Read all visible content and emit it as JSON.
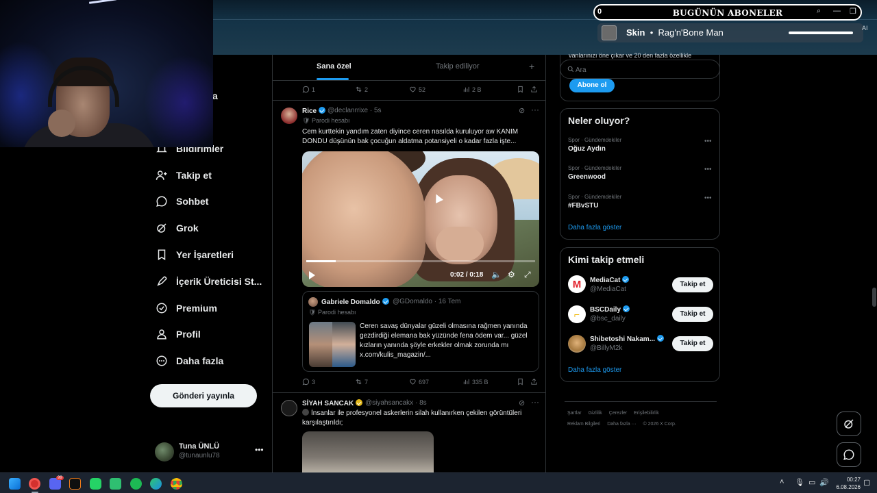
{
  "stream_overlay": {
    "alert_count": "0",
    "alert_title": "BUGÜNÜN ABONELER",
    "now_playing_title": "Skin",
    "now_playing_artist": "Rag'n'Bone Man",
    "ai_label": "AI",
    "ctrl_search": "⌕",
    "ctrl_min": "—",
    "ctrl_max": "❐",
    "ctrl_close": "✕"
  },
  "sidebar": {
    "partial_label": "a",
    "items": [
      {
        "label": "Bildirimler",
        "icon": "bell-icon"
      },
      {
        "label": "Takip et",
        "icon": "follow-icon"
      },
      {
        "label": "Sohbet",
        "icon": "chat-icon"
      },
      {
        "label": "Grok",
        "icon": "grok-icon"
      },
      {
        "label": "Yer İşaretleri",
        "icon": "bookmark-icon"
      },
      {
        "label": "İçerik Üreticisi St...",
        "icon": "rocket-icon"
      },
      {
        "label": "Premium",
        "icon": "premium-icon"
      },
      {
        "label": "Profil",
        "icon": "profile-icon"
      },
      {
        "label": "Daha fazla",
        "icon": "more-icon"
      }
    ],
    "post_button": "Gönderi yayınla",
    "account_name": "Tuna ÜNLÜ",
    "account_handle": "@tunaunlu78",
    "account_more": "•••"
  },
  "feed": {
    "tabs": {
      "for_you": "Sana özel",
      "following": "Takip ediliyor",
      "add": "+"
    },
    "top_actions": {
      "replies": "1",
      "reposts": "2",
      "likes": "52",
      "views": "2 B"
    },
    "tweet1": {
      "name": "Rice",
      "handle": "@declanrrixe",
      "time": "· 5s",
      "label": "Parodi hesabı",
      "text": "Cem kurttekin yandım zaten diyince ceren nasılda kuruluyor aw KANIM DONDU düşünün bak çocuğun aldatma potansiyeli o kadar fazla işte...",
      "video_time": "0:02 / 0:18",
      "progress": 0.13,
      "quote": {
        "name": "Gabriele Domaldo",
        "handle": "@GDomaldo",
        "time": "· 16 Tem",
        "label": "Parodi hesabı",
        "text": "Ceren savaş dünyalar güzeli olmasına rağmen yanında gezdirdiği elemana bak yüzünde fena ödem var... güzel kızların yanında şöyle erkekler olmak zorunda mı x.com/kulis_magazin/..."
      },
      "actions": {
        "replies": "3",
        "reposts": "7",
        "likes": "697",
        "views": "335 B"
      }
    },
    "tweet2": {
      "name": "SİYAH SANCAK",
      "handle": "@siyahsancakx",
      "time": "· 8s",
      "text": "İnsanlar ile profesyonel askerlerin silah kullanırken çekilen görüntüleri karşılaştırıldı;"
    }
  },
  "right": {
    "premium_cut_text": "vanlarınızı öne çıkar ve 20 den fazla özellikle",
    "search_placeholder": "Ara",
    "subscribe_button": "Abone ol",
    "trends": {
      "title": "Neler oluyor?",
      "items": [
        {
          "category": "Spor · Gündemdekiler",
          "name": "Oğuz Aydın"
        },
        {
          "category": "Spor · Gündemdekiler",
          "name": "Greenwood"
        },
        {
          "category": "Spor · Gündemdekiler",
          "name": "#FBvSTU"
        }
      ],
      "more": "Daha fazla göster",
      "dots": "•••"
    },
    "who_to_follow": {
      "title": "Kimi takip etmeli",
      "items": [
        {
          "name": "MediaCat",
          "handle": "@MediaCat",
          "button": "Takip et",
          "avatar_letter": "M"
        },
        {
          "name": "BSCDaily",
          "handle": "@bsc_daily",
          "button": "Takip et",
          "avatar_letter": "⌐"
        },
        {
          "name": "Shibetoshi Nakam...",
          "handle": "@BillyM2k",
          "button": "Takip et",
          "avatar_letter": ""
        }
      ],
      "more": "Daha fazla göster"
    },
    "footer": {
      "line1": [
        "Şartlar",
        "Gizlilik",
        "Çerezler",
        "Erişilebilirlik"
      ],
      "line2": [
        "Reklam Bilgileri",
        "Daha fazla ···",
        "© 2026 X Corp."
      ]
    }
  },
  "taskbar": {
    "clock_time": "00:27",
    "clock_date": "6.08.2026",
    "discord_badge": "99"
  },
  "colors": {
    "accent": "#1d9bf0",
    "background": "#000000",
    "border": "#2f3336",
    "muted_text": "#71767b"
  }
}
